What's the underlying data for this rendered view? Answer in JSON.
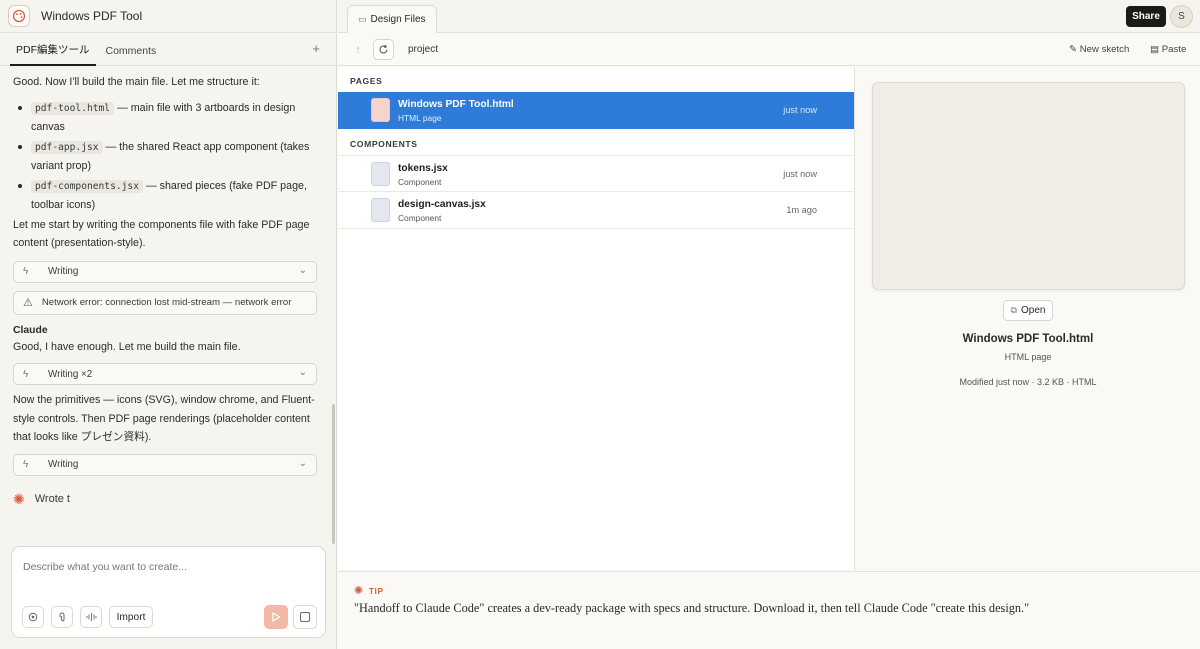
{
  "app": {
    "title": "Windows PDF Tool"
  },
  "left_tabs": [
    {
      "label": "PDF編集ツール"
    },
    {
      "label": "Comments"
    }
  ],
  "tab_add": "+",
  "chat": {
    "intro": "Good. Now I'll build the main file. Let me structure it:",
    "files": [
      {
        "code": "pdf-tool.html",
        "desc": " — main file with 3 artboards in design canvas"
      },
      {
        "code": "pdf-app.jsx",
        "desc": " — the shared React app component (takes variant prop)"
      },
      {
        "code": "pdf-components.jsx",
        "desc": " — shared pieces (fake PDF page, toolbar icons)"
      }
    ],
    "msg2": "Let me start by writing the components file with fake PDF page content (presentation-style).",
    "tool1": "Writing",
    "error": "Network error: connection lost mid-stream — network error",
    "speaker": "Claude",
    "msg3": "Good, I have enough. Let me build the main file.",
    "tool2": "Writing ×2",
    "msg4": "Now the primitives — icons (SVG), window chrome, and Fluent-style controls. Then PDF page renderings (placeholder content that looks like プレゼン資料).",
    "tool3": "Writing",
    "wrote": "Wrote t"
  },
  "composer": {
    "placeholder": "Describe what you want to create...",
    "import_label": "Import"
  },
  "topbar": {
    "doc_tab": "Design Files",
    "share": "Share",
    "avatar": "S"
  },
  "toolbar": {
    "path": "project",
    "new_sketch": "New sketch",
    "paste": "Paste"
  },
  "sections": {
    "pages": "PAGES",
    "components": "COMPONENTS"
  },
  "pages": [
    {
      "name": "Windows PDF Tool.html",
      "type": "HTML page",
      "time": "just now"
    }
  ],
  "components": [
    {
      "name": "tokens.jsx",
      "type": "Component",
      "time": "just now"
    },
    {
      "name": "design-canvas.jsx",
      "type": "Component",
      "time": "1m ago"
    }
  ],
  "preview": {
    "open": "Open",
    "name": "Windows PDF Tool.html",
    "type": "HTML page",
    "meta": "Modified just now · 3.2 KB · HTML"
  },
  "tip": {
    "label": "TIP",
    "text": "\"Handoff to Claude Code\" creates a dev-ready package with specs and structure. Download it, then tell Claude Code \"create this design.\""
  },
  "colors": {
    "accent": "#2f7bd9",
    "brand": "#d4603c",
    "share_bg": "#1b1a18"
  }
}
